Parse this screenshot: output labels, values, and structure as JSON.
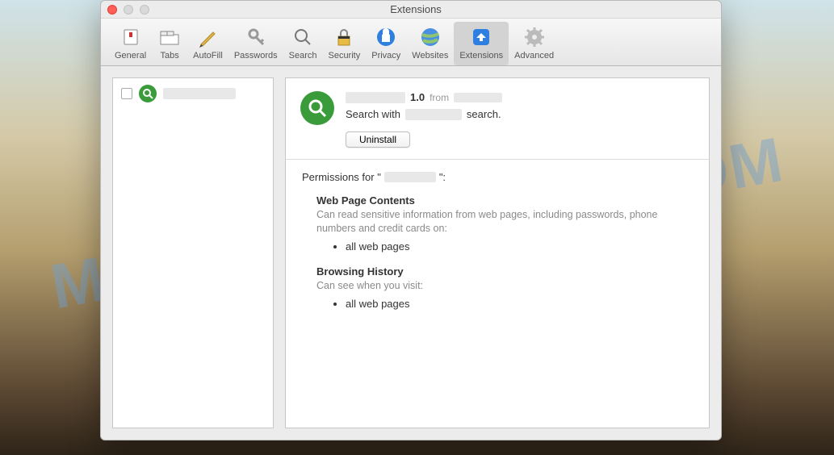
{
  "watermark": "MYANTISPYWARE.COM",
  "window": {
    "title": "Extensions"
  },
  "toolbar": [
    {
      "id": "general",
      "label": "General"
    },
    {
      "id": "tabs",
      "label": "Tabs"
    },
    {
      "id": "autofill",
      "label": "AutoFill"
    },
    {
      "id": "passwords",
      "label": "Passwords"
    },
    {
      "id": "search",
      "label": "Search"
    },
    {
      "id": "security",
      "label": "Security"
    },
    {
      "id": "privacy",
      "label": "Privacy"
    },
    {
      "id": "websites",
      "label": "Websites"
    },
    {
      "id": "extensions",
      "label": "Extensions"
    },
    {
      "id": "advanced",
      "label": "Advanced"
    }
  ],
  "toolbar_active": "extensions",
  "extension": {
    "version": "1.0",
    "from_label": "from",
    "desc_prefix": "Search with",
    "desc_suffix": "search.",
    "uninstall_label": "Uninstall"
  },
  "permissions": {
    "heading_prefix": "Permissions for \"",
    "heading_suffix": "\":",
    "sections": [
      {
        "title": "Web Page Contents",
        "desc": "Can read sensitive information from web pages, including passwords, phone numbers and credit cards on:",
        "items": [
          "all web pages"
        ]
      },
      {
        "title": "Browsing History",
        "desc": "Can see when you visit:",
        "items": [
          "all web pages"
        ]
      }
    ]
  }
}
